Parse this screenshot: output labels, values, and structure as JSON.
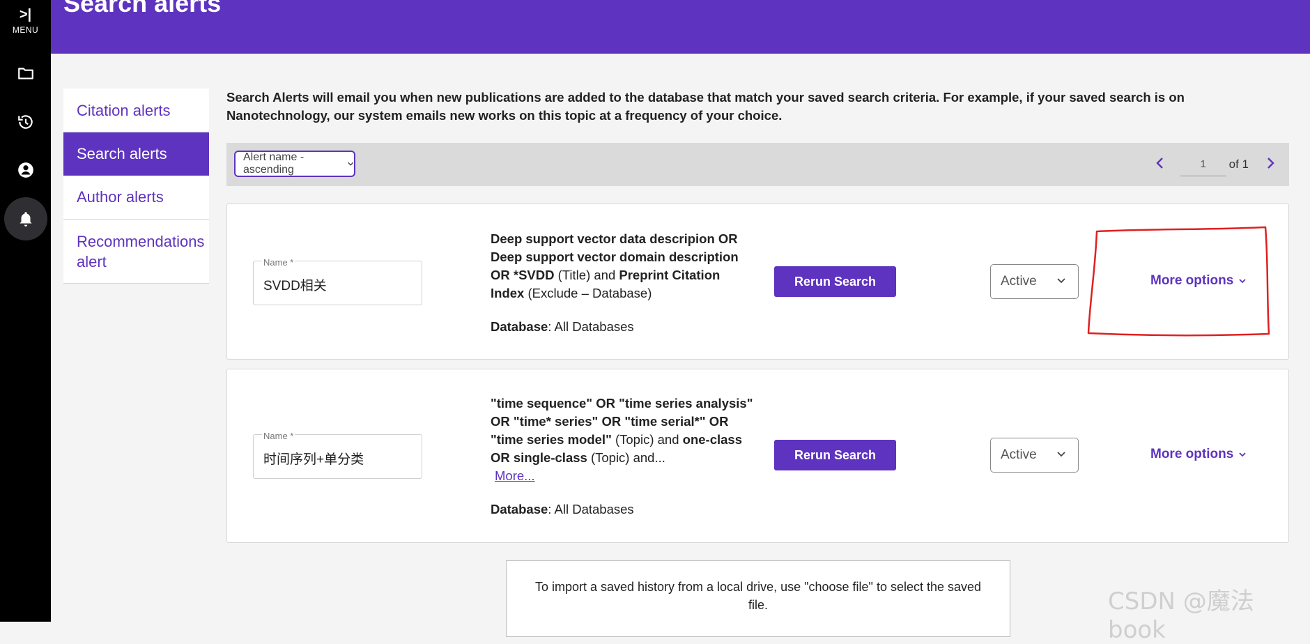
{
  "rail": {
    "menu_glyph": ">|",
    "menu_label": "MENU",
    "icons": [
      "folder-icon",
      "history-icon",
      "account-icon",
      "bell-icon"
    ]
  },
  "header": {
    "title": "Search alerts"
  },
  "sidenav": {
    "items": [
      {
        "label": "Citation alerts",
        "active": false
      },
      {
        "label": "Search alerts",
        "active": true
      },
      {
        "label": "Author alerts",
        "active": false
      },
      {
        "label": "Recommendations alert",
        "active": false
      }
    ]
  },
  "intro": "Search Alerts will email you when new publications are added to the database that match your saved search criteria. For example, if your saved search is on Nanotechnology, our system emails new works on this topic at a frequency of your choice.",
  "toolbar": {
    "sort_label": "Alert name - ascending",
    "page_value": "1",
    "page_of": "of 1"
  },
  "alerts": [
    {
      "name_label": "Name *",
      "name_value": "SVDD相关",
      "q1": "Deep support vector data descripion OR Deep support vector domain description OR *SVDD",
      "q2": " (Title) and ",
      "q3": "Preprint Citation Index",
      "q4": " (Exclude – Database)",
      "db_label": "Database",
      "db_value": ": All Databases",
      "rerun": "Rerun Search",
      "status": "Active",
      "more_options": "More options"
    },
    {
      "name_label": "Name *",
      "name_value": "时间序列+单分类",
      "q1": "\"time sequence\" OR \"time series analysis\" OR \"time* series\" OR \"time serial*\" OR \"time series model\"",
      "q2": " (Topic) and ",
      "q3": "one-class OR single-class",
      "q4": " (Topic) and...",
      "more_link": "More...",
      "db_label": "Database",
      "db_value": ": All Databases",
      "rerun": "Rerun Search",
      "status": "Active",
      "more_options": "More options"
    }
  ],
  "import_text": "To import a saved history from a local drive, use \"choose file\" to select the saved file.",
  "watermark": "CSDN @魔法book",
  "colors": {
    "brand": "#5e33bf",
    "rail": "#000000",
    "annotation": "#e02020"
  }
}
